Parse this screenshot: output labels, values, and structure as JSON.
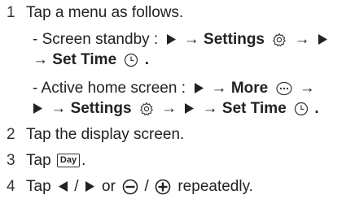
{
  "steps": [
    {
      "num": "1",
      "text": "Tap a menu as follows."
    },
    {
      "num": "2",
      "text": "Tap the display screen."
    },
    {
      "num": "3",
      "prefix": "Tap",
      "key": "Day",
      "suffix": "."
    },
    {
      "num": "4",
      "prefix": "Tap",
      "sep1": "/",
      "or": "or",
      "sep2": "/",
      "suffix": "repeatedly."
    }
  ],
  "standby": {
    "label": "- Screen standby :",
    "arrow": "→",
    "settings": "Settings",
    "set_time": "Set Time",
    "period": "."
  },
  "home": {
    "label": "- Active home screen :",
    "arrow": "→",
    "more": "More",
    "settings": "Settings",
    "set_time": "Set Time",
    "period": "."
  },
  "icons": {
    "play": "play-icon",
    "gear": "gear-icon",
    "clock": "clock-icon",
    "more": "more-icon",
    "left": "left-arrow-icon",
    "minus": "minus-circle-icon",
    "plus": "plus-circle-icon"
  }
}
